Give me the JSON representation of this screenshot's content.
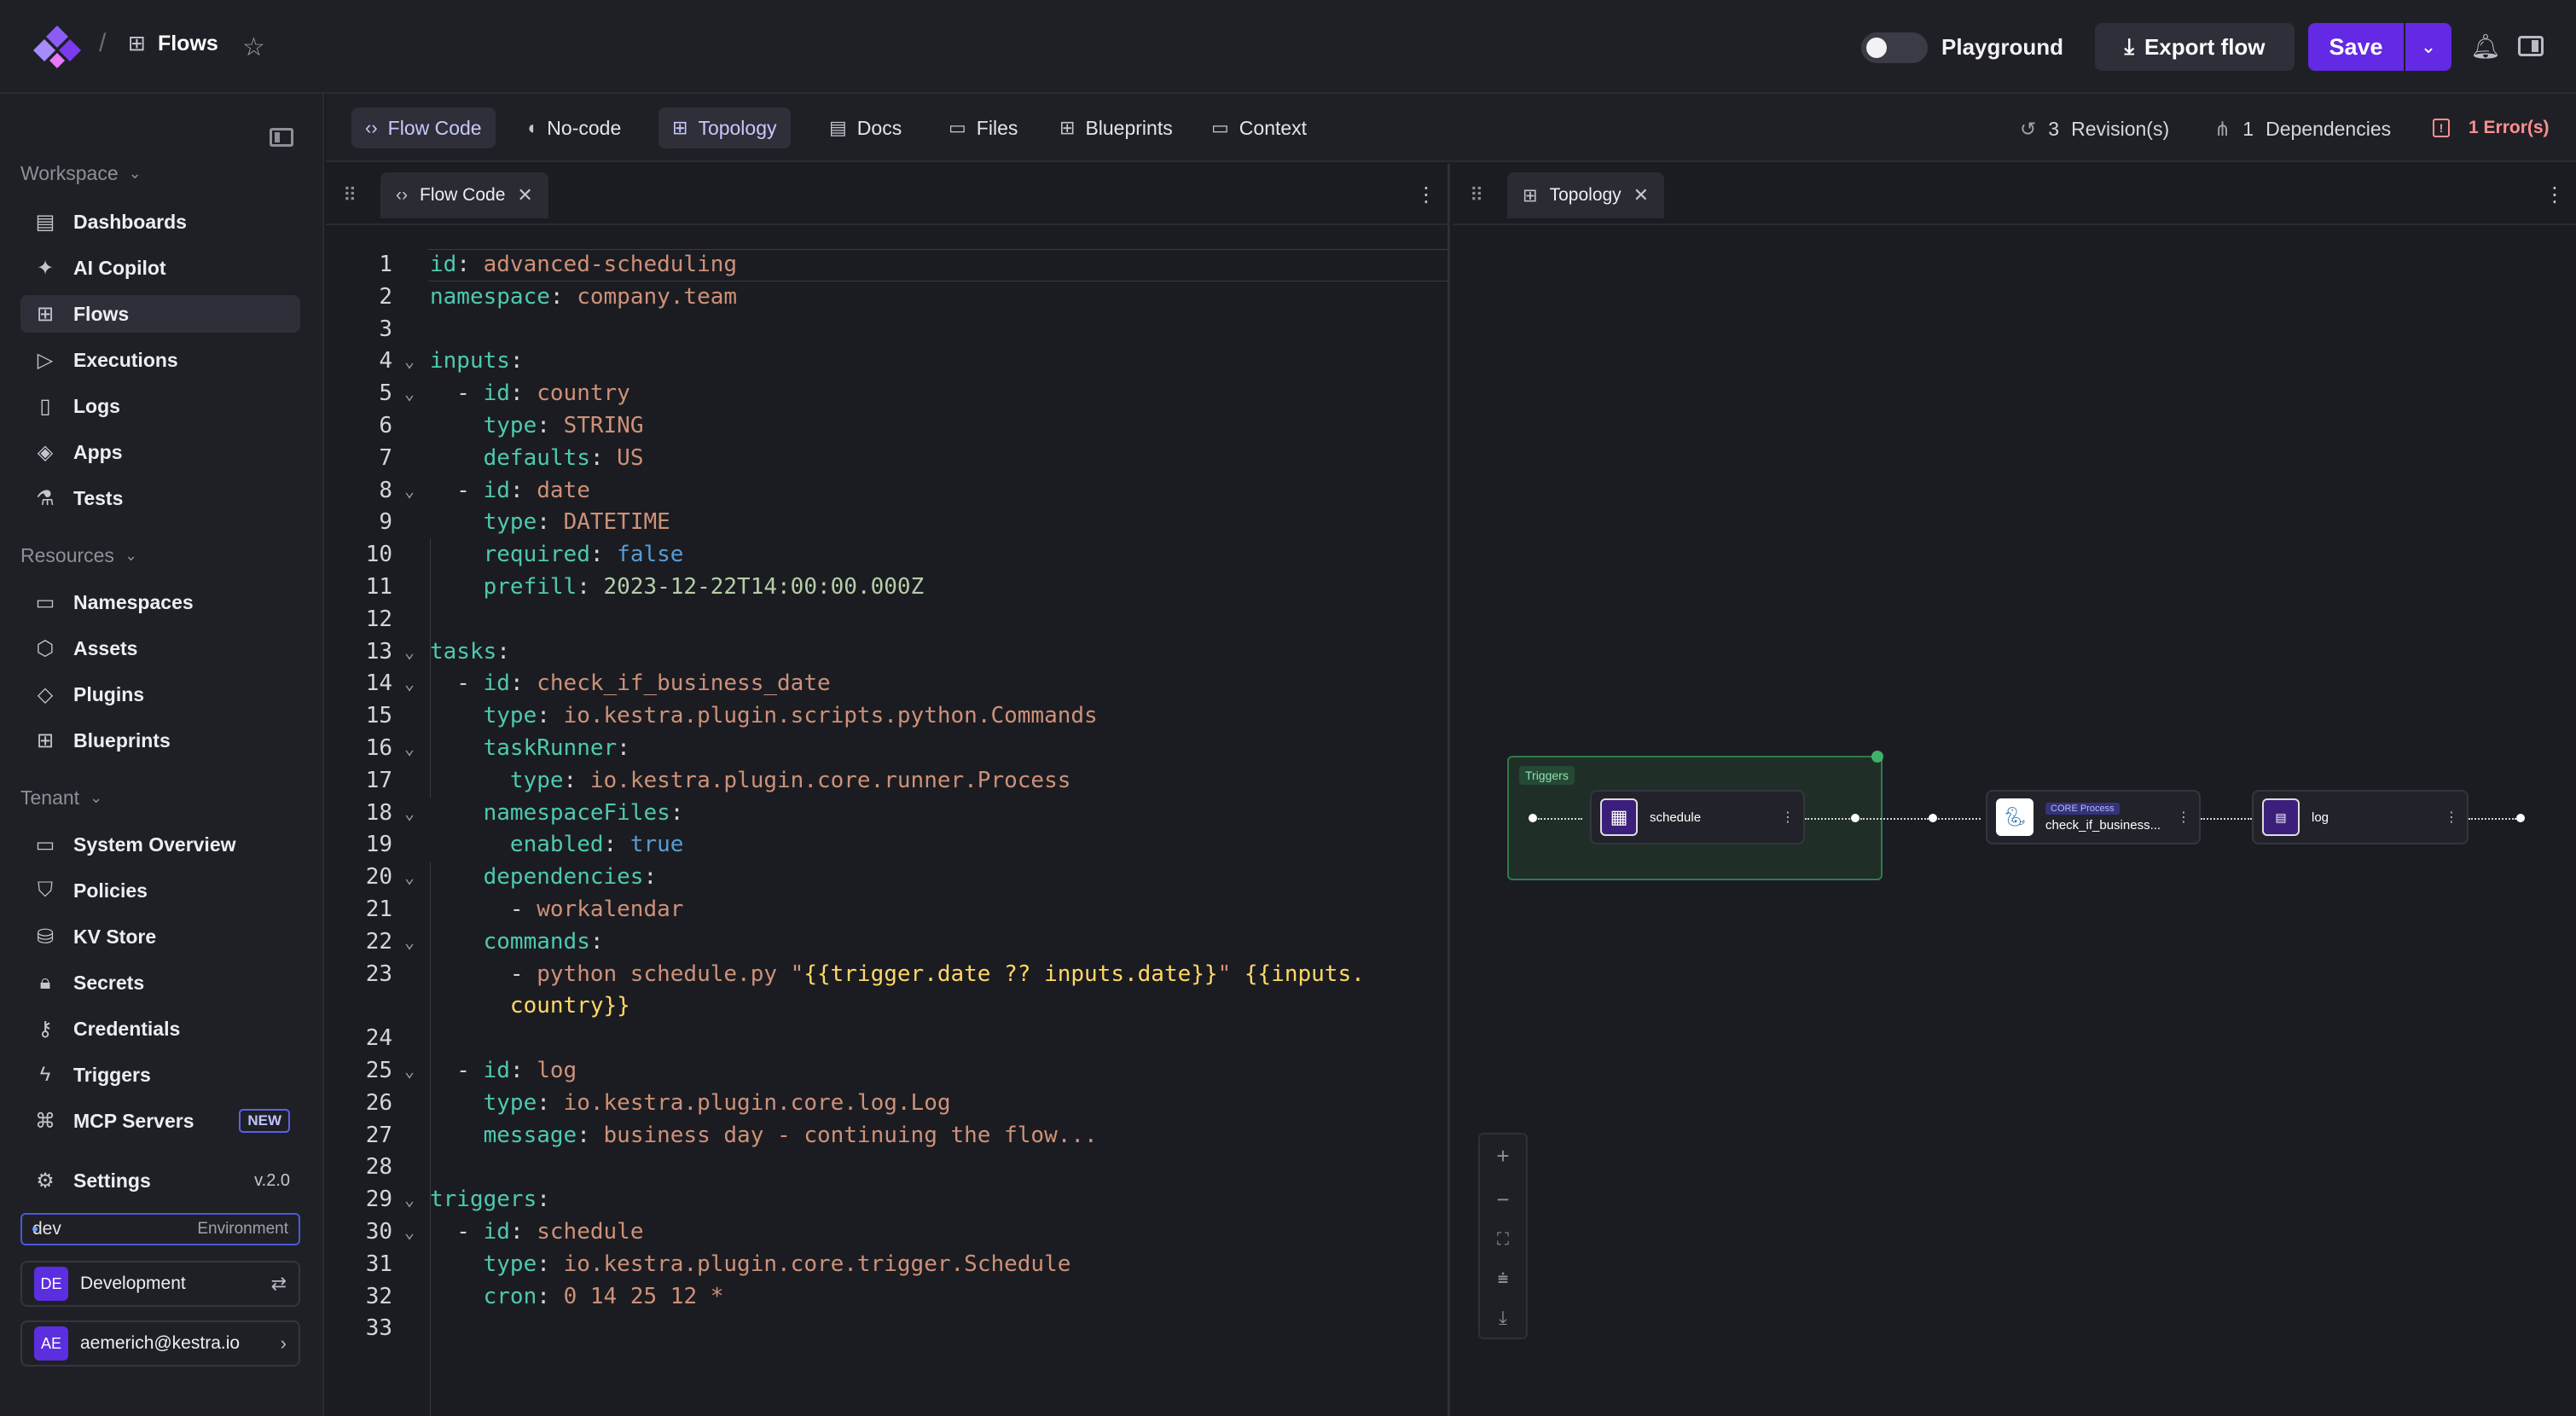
{
  "topbar": {
    "breadcrumb_sep": "/",
    "page": "Flows",
    "playground_label": "Playground",
    "export_label": "Export flow",
    "save_label": "Save"
  },
  "sidebar": {
    "workspace_label": "Workspace",
    "workspace_items": [
      {
        "label": "Dashboards",
        "icon": "dashboard-icon"
      },
      {
        "label": "AI Copilot",
        "icon": "sparkle-icon"
      },
      {
        "label": "Flows",
        "icon": "flows-icon",
        "active": true
      },
      {
        "label": "Executions",
        "icon": "play-icon"
      },
      {
        "label": "Logs",
        "icon": "file-icon"
      },
      {
        "label": "Apps",
        "icon": "layers-icon"
      },
      {
        "label": "Tests",
        "icon": "flask-icon"
      }
    ],
    "resources_label": "Resources",
    "resources_items": [
      {
        "label": "Namespaces",
        "icon": "folder-icon"
      },
      {
        "label": "Assets",
        "icon": "cube-icon"
      },
      {
        "label": "Plugins",
        "icon": "plugin-icon"
      },
      {
        "label": "Blueprints",
        "icon": "blueprint-icon"
      }
    ],
    "tenant_label": "Tenant",
    "tenant_items": [
      {
        "label": "System Overview",
        "icon": "monitor-icon"
      },
      {
        "label": "Policies",
        "icon": "shield-icon"
      },
      {
        "label": "KV Store",
        "icon": "database-icon"
      },
      {
        "label": "Secrets",
        "icon": "lock-icon"
      },
      {
        "label": "Credentials",
        "icon": "key-icon"
      },
      {
        "label": "Triggers",
        "icon": "bolt-icon"
      },
      {
        "label": "MCP Servers",
        "icon": "mcp-icon",
        "badge": "NEW"
      }
    ],
    "settings_label": "Settings",
    "version": "v.2.0",
    "env_name": "dev",
    "env_label": "Environment",
    "tenant_initials": "DE",
    "tenant_name": "Development",
    "user_initials": "AE",
    "user_email": "aemerich@kestra.io"
  },
  "tabs": [
    {
      "label": "Flow Code",
      "icon": "code-icon",
      "active": true
    },
    {
      "label": "No-code",
      "icon": "mouse-icon"
    },
    {
      "label": "Topology",
      "icon": "topology-icon",
      "active": true
    },
    {
      "label": "Docs",
      "icon": "doc-icon"
    },
    {
      "label": "Files",
      "icon": "folder-icon"
    },
    {
      "label": "Blueprints",
      "icon": "blueprint-icon"
    },
    {
      "label": "Context",
      "icon": "folder-icon"
    }
  ],
  "meta": {
    "revisions_count": "3",
    "revisions_label": "Revision(s)",
    "deps_count": "1",
    "deps_label": "Dependencies",
    "errors_label": "1 Error(s)"
  },
  "code_panel": {
    "tab_label": "Flow Code",
    "line_numbers": [
      "1",
      "2",
      "3",
      "4",
      "5",
      "6",
      "7",
      "8",
      "9",
      "10",
      "11",
      "12",
      "13",
      "14",
      "15",
      "16",
      "17",
      "18",
      "19",
      "20",
      "21",
      "22",
      "23",
      "",
      "24",
      "25",
      "26",
      "27",
      "28",
      "29",
      "30",
      "31",
      "32",
      "33"
    ]
  },
  "topology_panel": {
    "tab_label": "Topology",
    "triggers_label": "Triggers",
    "node_schedule": "schedule",
    "node_task_badge": "CORE Process",
    "node_task": "check_if_business...",
    "node_log": "log"
  },
  "colors": {
    "accent": "#6329e4",
    "active_tab_text": "#c7c9ff",
    "error": "#ff8f8f",
    "yaml_key": "#4ec9b0",
    "yaml_value": "#ce9178"
  }
}
